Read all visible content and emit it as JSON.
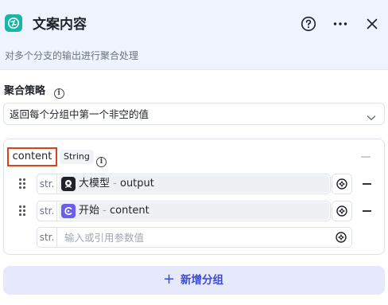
{
  "header": {
    "title": "文案内容",
    "node_icon": "variable-aggregate-icon",
    "help_icon": "help-circle-icon",
    "more_icon": "more-dots-icon",
    "close_icon": "close-icon"
  },
  "description": "对多个分支的输出进行聚合处理",
  "strategy": {
    "label": "聚合策略",
    "selected": "返回每个分组中第一个非空的值"
  },
  "group": {
    "name": "content",
    "type": "String",
    "variables": [
      {
        "prefix": "str.",
        "node": "大模型",
        "sep": " - ",
        "field": "output",
        "icon": "llm-icon",
        "icon_color": "#1f2329"
      },
      {
        "prefix": "str.",
        "node": "开始",
        "sep": " - ",
        "field": "content",
        "icon": "start-icon",
        "icon_color": "#6d5ee6"
      }
    ],
    "new_input": {
      "prefix": "str.",
      "placeholder": "输入或引用参数值"
    }
  },
  "add_group": {
    "plus": "+",
    "label": "新增分组"
  },
  "colors": {
    "header_bg": "#eef3fd",
    "node_icon_bg": "#18b5a8",
    "highlight_border": "#d9421a",
    "accent": "#3d4bd1"
  }
}
